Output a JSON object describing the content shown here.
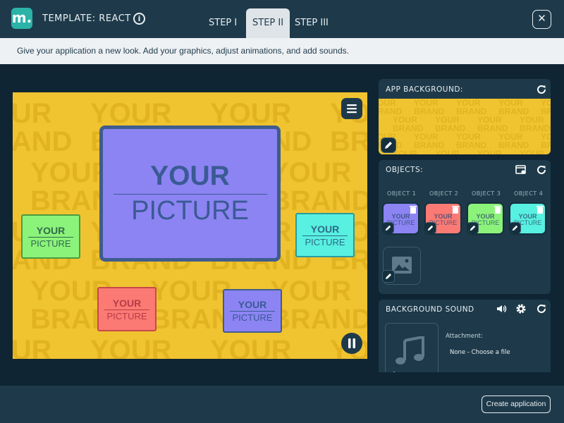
{
  "header": {
    "logo_text": "m.",
    "template_title": "TEMPLATE: REACT",
    "info_icon": "i",
    "steps": [
      {
        "label": "STEP I",
        "active": false
      },
      {
        "label": "STEP II",
        "active": true
      },
      {
        "label": "STEP III",
        "active": false
      }
    ],
    "close_label": "✕"
  },
  "instruction": "Give your application a new look. Add your graphics, adjust animations, and add sounds.",
  "stage": {
    "watermark": {
      "line1": "YOUR",
      "line2": "BRAND"
    },
    "pictures": [
      {
        "line1": "YOUR",
        "line2": "PICTURE",
        "color": "#8c84f3",
        "border": "#3f5c8e",
        "text_color": "#3a5a94"
      },
      {
        "line1": "YOUR",
        "line2": "PICTURE",
        "color": "#8cf37a",
        "border": "#4d9a3f",
        "text_color": "#2f6a4b"
      },
      {
        "line1": "YOUR",
        "line2": "PICTURE",
        "color": "#58f0e0",
        "border": "#2a9aa0",
        "text_color": "#2f6a8a"
      },
      {
        "line1": "YOUR",
        "line2": "PICTURE",
        "color": "#fb7a74",
        "border": "#c44a4a",
        "text_color": "#b63c48"
      },
      {
        "line1": "YOUR",
        "line2": "PICTURE",
        "color": "#8c84f3",
        "border": "#3f5c8e",
        "text_color": "#3a5a94"
      }
    ],
    "menu_icon": "hamburger-menu-icon",
    "pause_icon": "pause-icon"
  },
  "panels": {
    "app_background": {
      "title": "APP BACKGROUND:",
      "reset_icon": "refresh-icon"
    },
    "objects": {
      "title": "OBJECTS:",
      "items": [
        {
          "label": "OBJECT 1",
          "color": "#8c84f3"
        },
        {
          "label": "OBJECT 2",
          "color": "#fb7a74"
        },
        {
          "label": "OBJECT 3",
          "color": "#8cf37a"
        },
        {
          "label": "OBJECT 4",
          "color": "#58f0e0"
        }
      ],
      "thumb_text": {
        "line1": "YOUR",
        "line2": "PICTURE"
      }
    },
    "background_sound": {
      "title": "BACKGROUND SOUND",
      "attachment_label": "Attachment:",
      "attachment_value": "None - Choose a file"
    }
  },
  "footer": {
    "create_label": "Create application"
  },
  "colors": {
    "accent": "#2bb3a8",
    "panel": "#1e3a4a",
    "background": "#0f2533",
    "stage": "#f0c430"
  }
}
